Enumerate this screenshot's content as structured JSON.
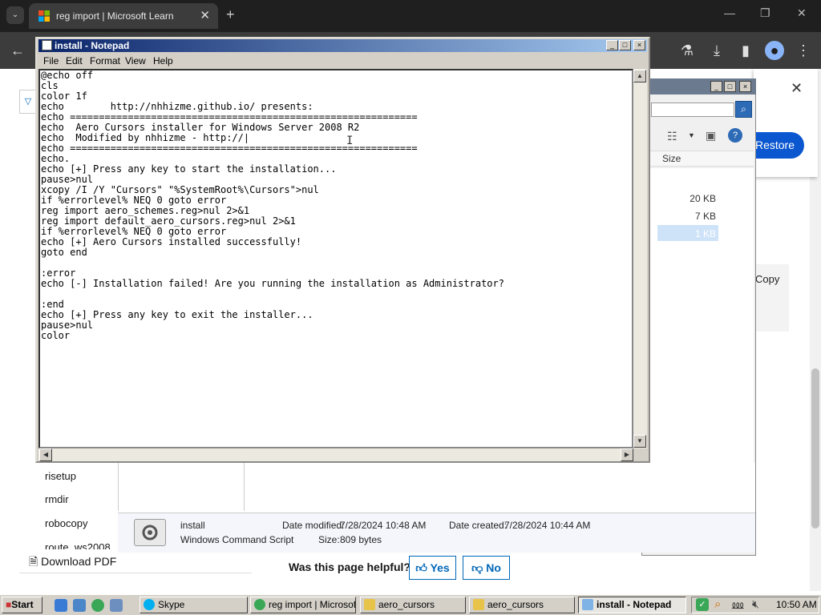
{
  "browser": {
    "tab_title": "reg import | Microsoft Learn",
    "tab_close": "✕",
    "new_tab": "+",
    "tab_search": "⌄",
    "window_controls": {
      "minimize": "—",
      "maximize": "❐",
      "close": "✕"
    },
    "toolbar_icons": [
      "back-icon",
      "labs-icon",
      "download-icon",
      "sidebar-icon",
      "profile-icon",
      "menu-icon"
    ]
  },
  "page": {
    "restore_button": "Restore",
    "close_panel": "✕",
    "copy_label": "Copy",
    "sidebar_links": [
      "risetup",
      "rmdir",
      "robocopy",
      "route_ws2008"
    ],
    "download_pdf": "Download PDF",
    "helpful_question": "Was this page helpful?",
    "yes_label": "Yes",
    "no_label": "No"
  },
  "explorer": {
    "size_header": "Size",
    "sizes": [
      "20 KB",
      "7 KB",
      "1 KB"
    ],
    "file_name": "install",
    "file_type": "Windows Command Script",
    "date_modified_label": "Date modified:",
    "date_modified": "7/28/2024 10:48 AM",
    "date_created_label": "Date created:",
    "date_created": "7/28/2024 10:44 AM",
    "size_label": "Size:",
    "size_value": "809 bytes"
  },
  "notepad": {
    "title": "install - Notepad",
    "menu": [
      "File",
      "Edit",
      "Format",
      "View",
      "Help"
    ],
    "content": "@echo off\ncls\ncolor 1f\necho        http://nhhizme.github.io/ presents:\necho ============================================================\necho  Aero Cursors installer for Windows Server 2008 R2\necho  Modified by nhhizme - http://∣\necho ============================================================\necho.\necho [+] Press any key to start the installation...\npause>nul\nxcopy /I /Y \"Cursors\" \"%SystemRoot%\\Cursors\">nul\nif %errorlevel% NEQ 0 goto error\nreg import aero_schemes.reg>nul 2>&1\nreg import default_aero_cursors.reg>nul 2>&1\nif %errorlevel% NEQ 0 goto error\necho [+] Aero Cursors installed successfully!\ngoto end\n\n:error\necho [-] Installation failed! Are you running the installation as Administrator?\n\n:end\necho [+] Press any key to exit the installer...\npause>nul\ncolor"
  },
  "taskbar": {
    "start_label": "Start",
    "tasks": [
      {
        "label": "Skype",
        "icon_color": "#00aff0"
      },
      {
        "label": "reg import | Microsoft...",
        "icon_color": "#3aa757"
      },
      {
        "label": "aero_cursors",
        "icon_color": "#e8c34a"
      },
      {
        "label": "aero_cursors",
        "icon_color": "#e8c34a"
      },
      {
        "label": "install - Notepad",
        "icon_color": "#7fb2e5"
      }
    ],
    "clock": "10:50 AM"
  },
  "colors": {
    "chrome_dark": "#1f1f1f",
    "chrome_toolbar": "#3c3c3c",
    "ms_blue": "#0067b8",
    "restore_blue": "#0b57d0",
    "win_classic_face": "#d4d0c8",
    "titlebar_start": "#0a246a",
    "titlebar_end": "#a6caf0"
  }
}
